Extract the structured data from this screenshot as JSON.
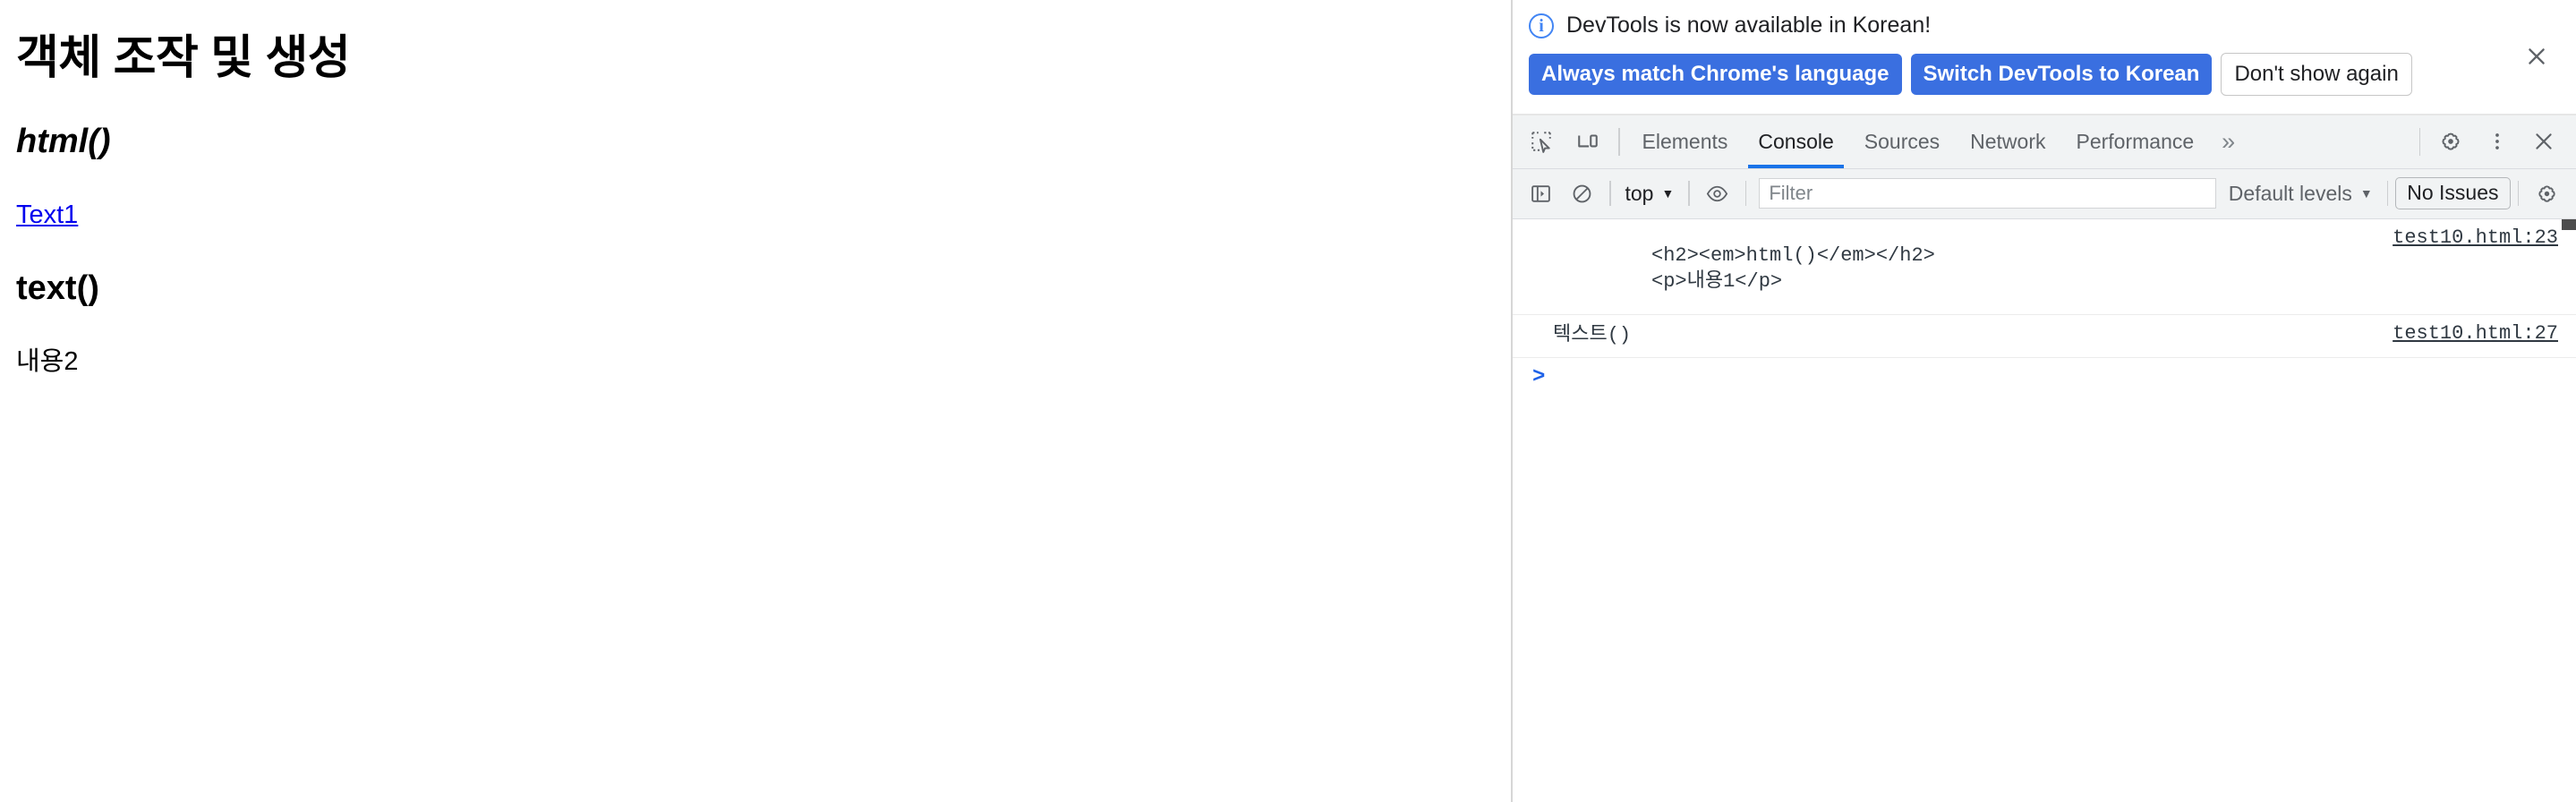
{
  "page": {
    "heading": "객체 조작 및 생성",
    "subheading_html": "html()",
    "link_text": "Text1",
    "subheading_text": "text()",
    "paragraph": "내용2"
  },
  "devtools": {
    "infobar": {
      "icon": "info-icon",
      "message": "DevTools is now available in Korean!",
      "primary_button_1": "Always match Chrome's language",
      "primary_button_2": "Switch DevTools to Korean",
      "secondary_button": "Don't show again",
      "close_icon": "close-icon",
      "accent_color": "#3a6fe0",
      "info_color": "#4285f4"
    },
    "tabbar": {
      "inspect_icon": "inspect-element-icon",
      "device_icon": "device-toolbar-icon",
      "tabs": [
        {
          "label": "Elements",
          "active": false
        },
        {
          "label": "Console",
          "active": true
        },
        {
          "label": "Sources",
          "active": false
        },
        {
          "label": "Network",
          "active": false
        },
        {
          "label": "Performance",
          "active": false
        }
      ],
      "overflow_label": "»",
      "settings_icon": "gear-icon",
      "more_icon": "kebab-menu-icon",
      "close_icon": "close-icon",
      "active_underline_color": "#1a73e8"
    },
    "console_toolbar": {
      "sidebar_icon": "show-console-sidebar-icon",
      "clear_icon": "clear-console-icon",
      "context_selector": "top",
      "eye_icon": "live-expression-icon",
      "filter_placeholder": "Filter",
      "filter_value": "",
      "levels_label": "Default levels",
      "issues_label": "No Issues",
      "settings_icon": "gear-icon"
    },
    "console_messages": [
      {
        "text": "<h2><em>html()</em></h2>\n<p>내용1</p>",
        "source": "test10.html:23",
        "indent": "deep"
      },
      {
        "text": "텍스트()",
        "source": "test10.html:27",
        "indent": "shallow"
      }
    ],
    "prompt": ">"
  }
}
